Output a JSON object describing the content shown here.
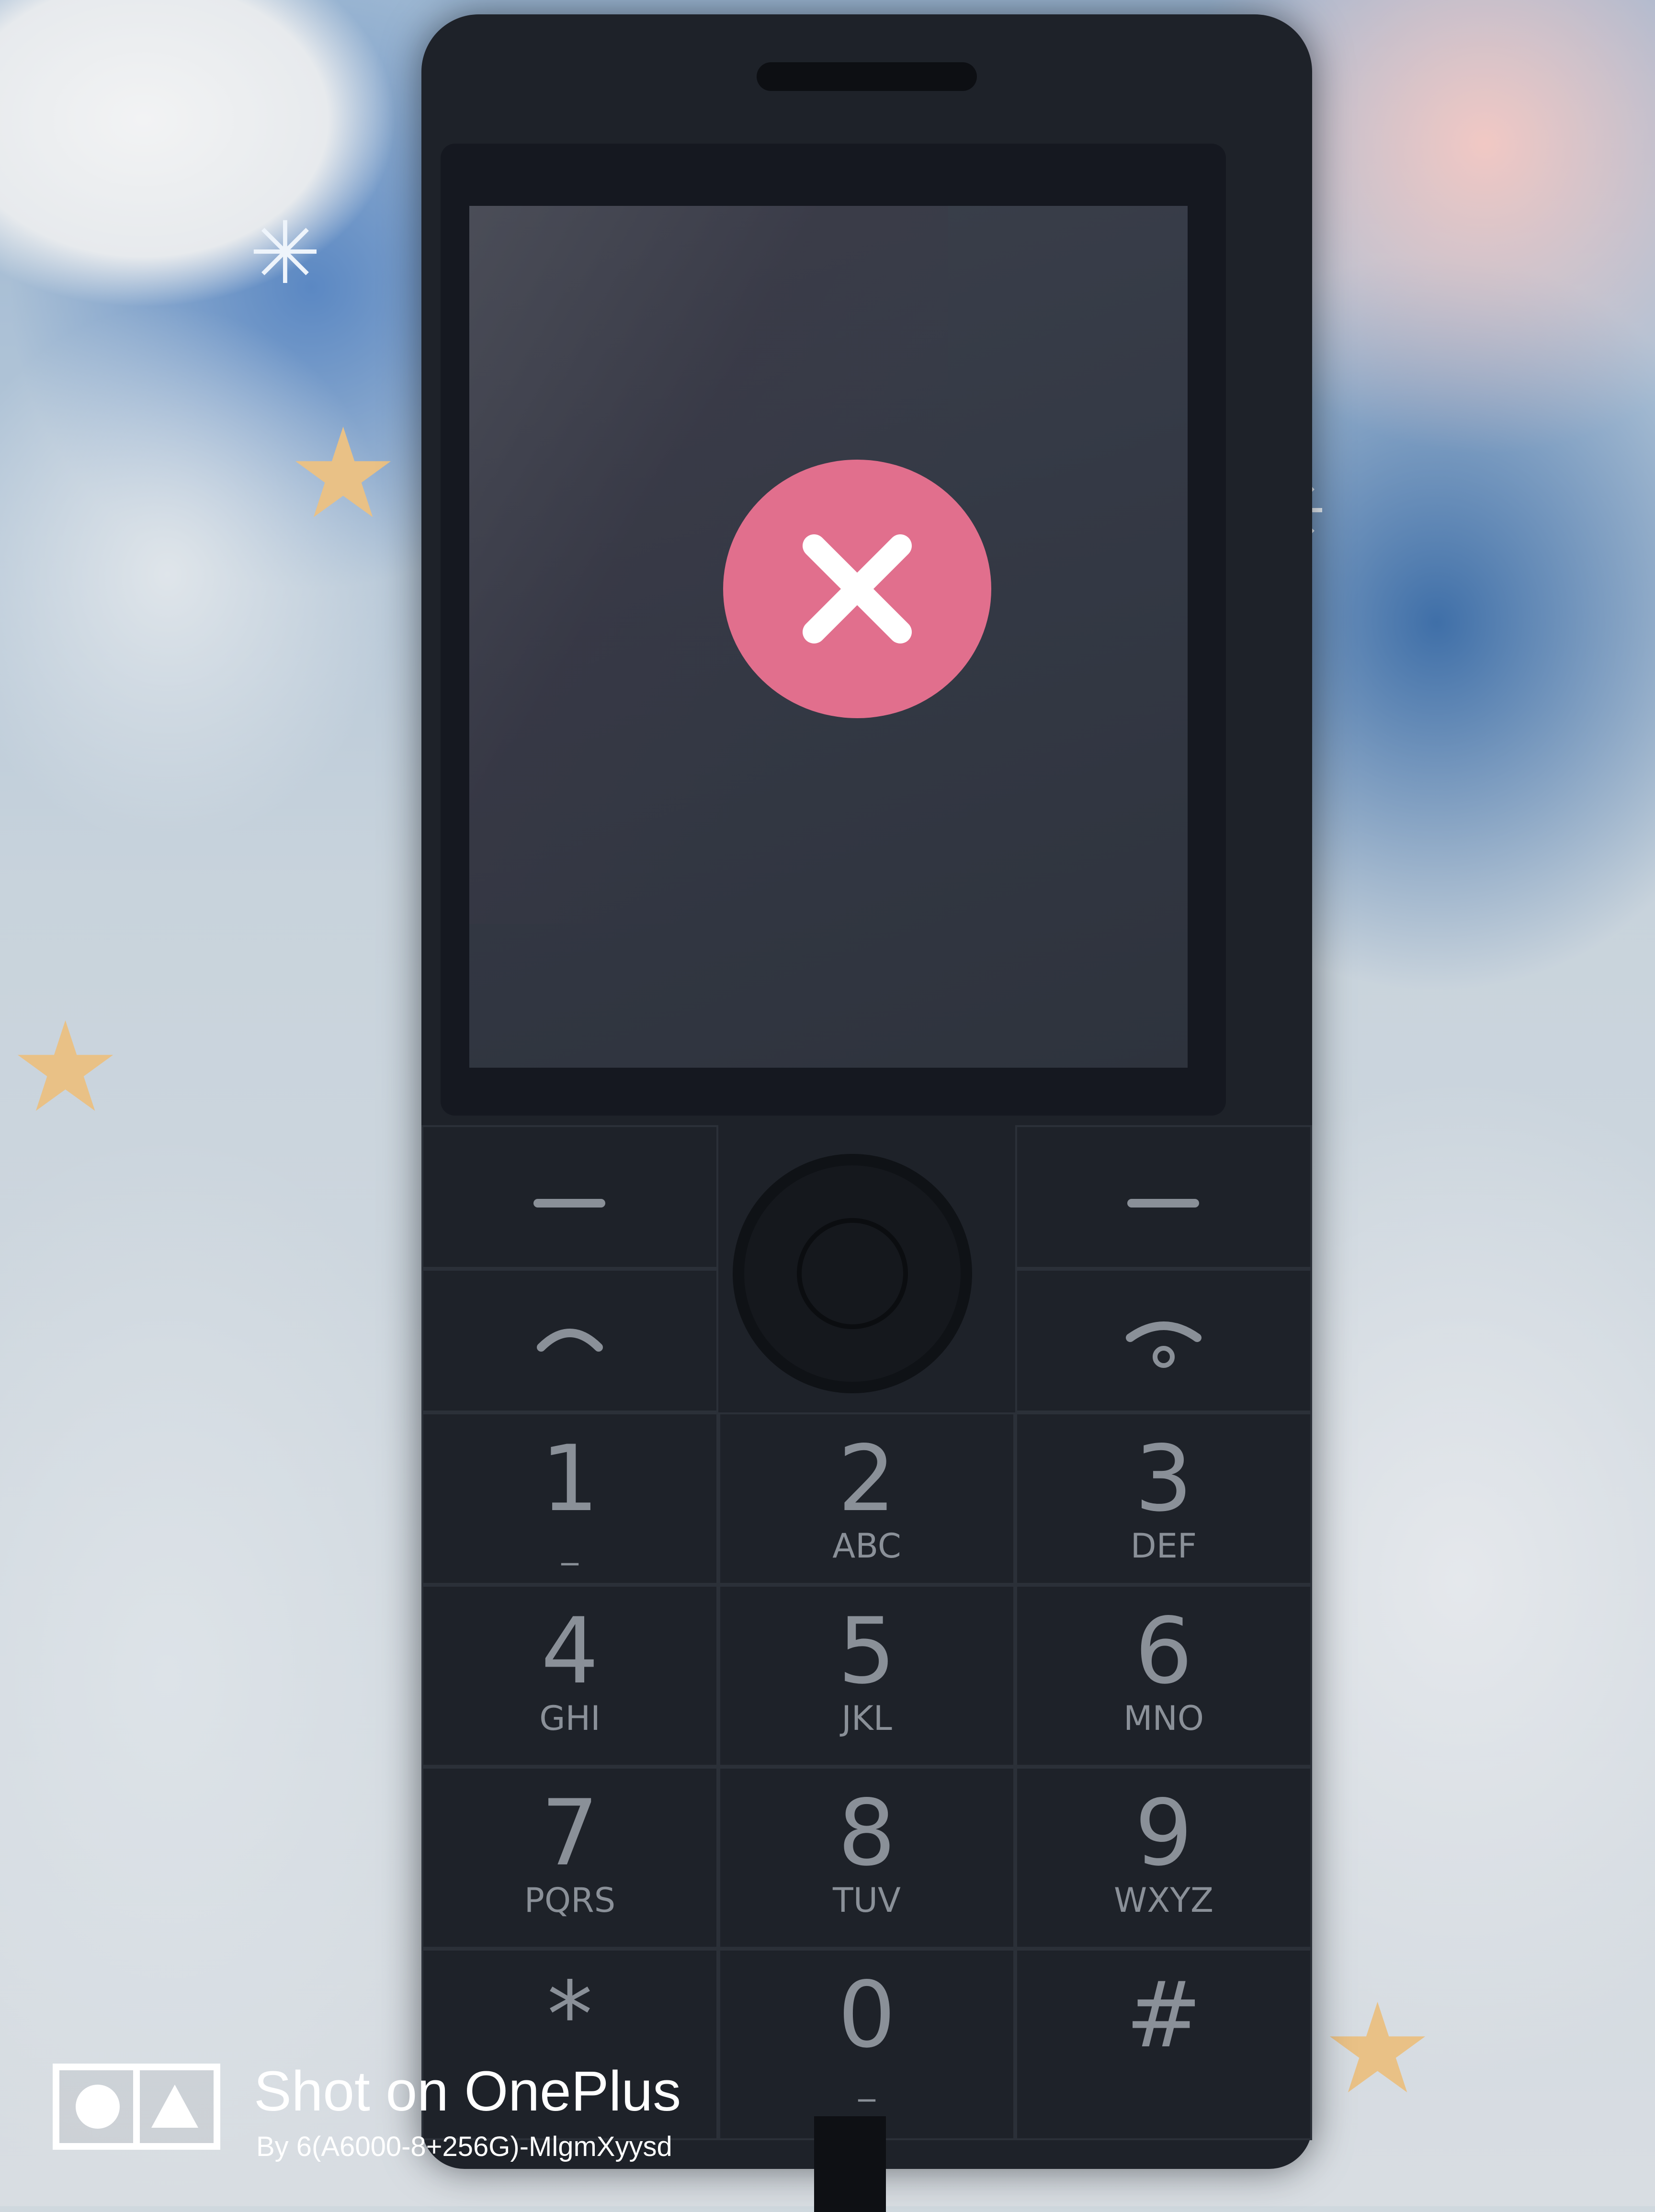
{
  "watermark": {
    "title": "Shot on OnePlus",
    "subtitle": "By 6(A6000-8+256G)-MlgmXyysd"
  },
  "screen": {
    "status_icon": "close-icon",
    "accent_color": "#e16f8d"
  },
  "keypad": {
    "keys": [
      {
        "num": "1",
        "sub": "_"
      },
      {
        "num": "2",
        "sub": "ABC"
      },
      {
        "num": "3",
        "sub": "DEF"
      },
      {
        "num": "4",
        "sub": "GHI"
      },
      {
        "num": "5",
        "sub": "JKL"
      },
      {
        "num": "6",
        "sub": "MNO"
      },
      {
        "num": "7",
        "sub": "PQRS"
      },
      {
        "num": "8",
        "sub": "TUV"
      },
      {
        "num": "9",
        "sub": "WXYZ"
      },
      {
        "num": "*",
        "sub": ""
      },
      {
        "num": "0",
        "sub": "_"
      },
      {
        "num": "#",
        "sub": ""
      }
    ]
  }
}
